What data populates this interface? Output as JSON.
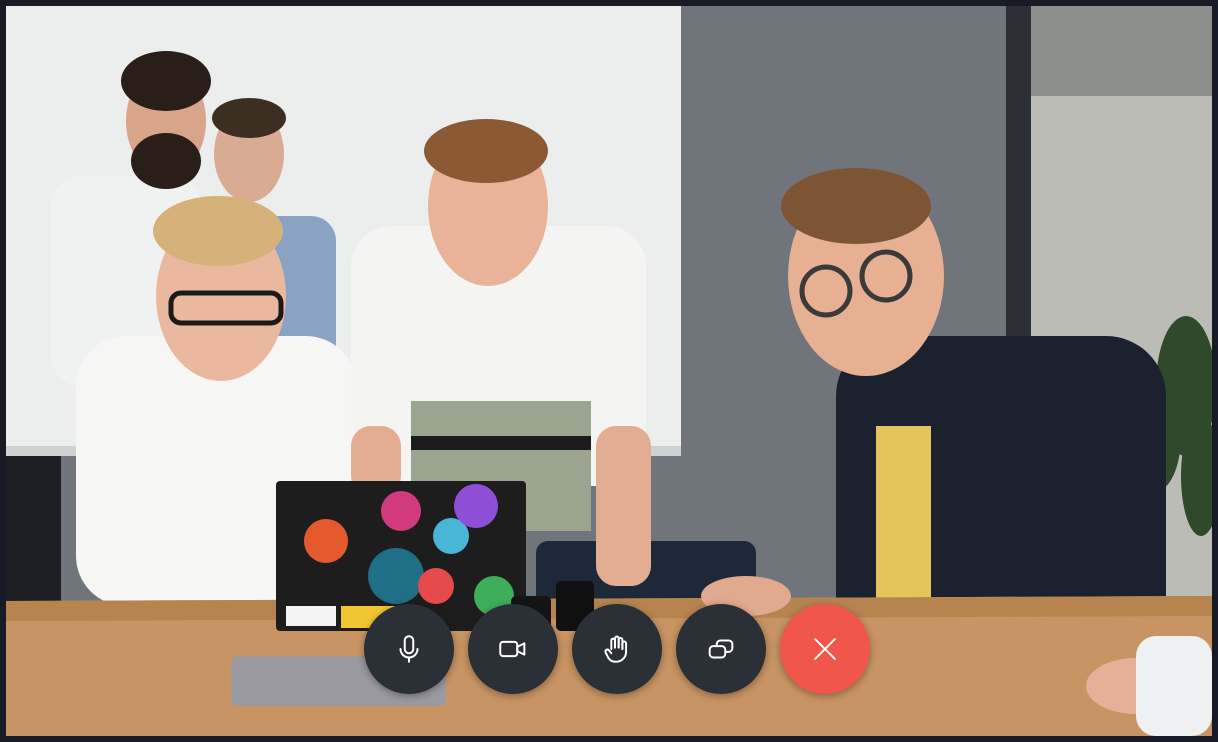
{
  "call": {
    "controls": [
      {
        "id": "mic",
        "icon": "microphone-icon",
        "action": "toggle-microphone"
      },
      {
        "id": "camera",
        "icon": "video-camera-icon",
        "action": "toggle-camera"
      },
      {
        "id": "hand",
        "icon": "raise-hand-icon",
        "action": "raise-hand"
      },
      {
        "id": "screen",
        "icon": "screen-share-icon",
        "action": "share-screen"
      },
      {
        "id": "hangup",
        "icon": "close-icon",
        "action": "end-call"
      }
    ],
    "colors": {
      "control_bg": "#2b2f36",
      "hangup_bg": "#f0574a",
      "icon": "#ffffff"
    }
  }
}
